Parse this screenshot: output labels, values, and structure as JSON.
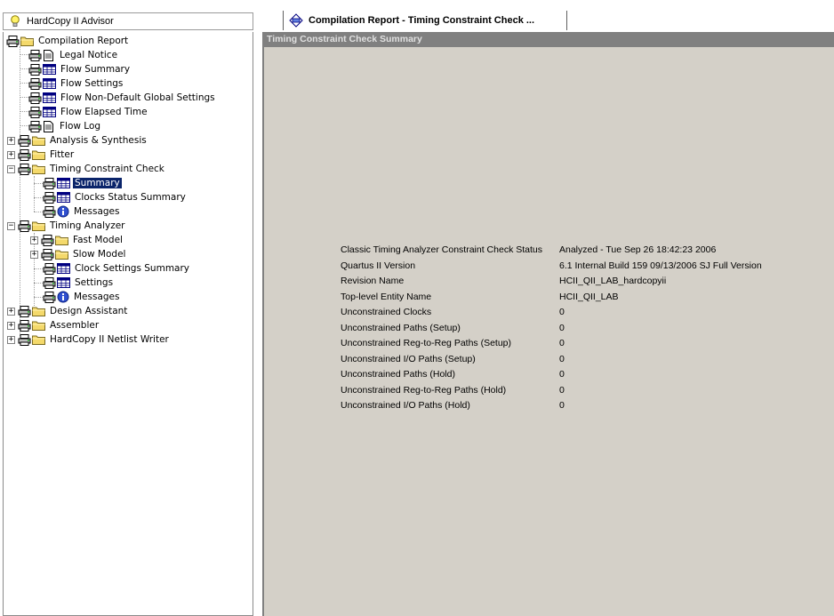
{
  "tabs": {
    "advisor_label": "HardCopy II Advisor",
    "report_label": "Compilation Report - Timing Constraint Check ..."
  },
  "tree": {
    "items": [
      {
        "label": "Compilation Report"
      },
      {
        "label": "Legal Notice"
      },
      {
        "label": "Flow Summary"
      },
      {
        "label": "Flow Settings"
      },
      {
        "label": "Flow Non-Default Global Settings"
      },
      {
        "label": "Flow Elapsed Time"
      },
      {
        "label": "Flow Log"
      },
      {
        "label": "Analysis & Synthesis"
      },
      {
        "label": "Fitter"
      },
      {
        "label": "Timing Constraint Check"
      },
      {
        "label": "Summary"
      },
      {
        "label": "Clocks Status Summary"
      },
      {
        "label": "Messages"
      },
      {
        "label": "Timing Analyzer"
      },
      {
        "label": "Fast Model"
      },
      {
        "label": "Slow Model"
      },
      {
        "label": "Clock Settings Summary"
      },
      {
        "label": "Settings"
      },
      {
        "label": "Messages"
      },
      {
        "label": "Design Assistant"
      },
      {
        "label": "Assembler"
      },
      {
        "label": "HardCopy II Netlist Writer"
      }
    ],
    "expander_open": "−",
    "expander_closed": "+"
  },
  "panel": {
    "title": "Timing Constraint Check Summary",
    "rows": [
      {
        "k": "Classic Timing Analyzer Constraint Check Status",
        "v": "Analyzed - Tue Sep 26 18:42:23 2006"
      },
      {
        "k": "Quartus II Version",
        "v": "6.1 Internal Build 159 09/13/2006 SJ Full Version"
      },
      {
        "k": "Revision Name",
        "v": "HCII_QII_LAB_hardcopyii"
      },
      {
        "k": "Top-level Entity Name",
        "v": "HCII_QII_LAB"
      },
      {
        "k": "Unconstrained Clocks",
        "v": "0"
      },
      {
        "k": "Unconstrained Paths (Setup)",
        "v": "0"
      },
      {
        "k": "Unconstrained Reg-to-Reg Paths (Setup)",
        "v": "0"
      },
      {
        "k": "Unconstrained I/O Paths (Setup)",
        "v": "0"
      },
      {
        "k": "Unconstrained Paths (Hold)",
        "v": "0"
      },
      {
        "k": "Unconstrained Reg-to-Reg Paths (Hold)",
        "v": "0"
      },
      {
        "k": "Unconstrained I/O Paths (Hold)",
        "v": "0"
      }
    ]
  },
  "colors": {
    "selection": "#0a246a",
    "panel_bg": "#d4d0c8",
    "header_bg": "#808080",
    "folder": "#f4d96b"
  }
}
